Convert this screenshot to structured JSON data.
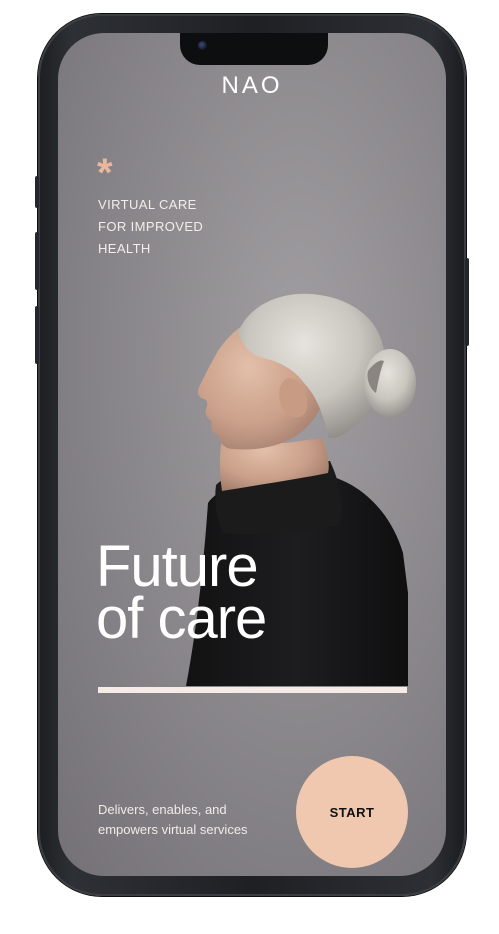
{
  "app": {
    "brand": "NAO",
    "asterisk": "*",
    "tagline_lines": [
      "VIRTUAL CARE",
      "FOR IMPROVED",
      "HEALTH"
    ]
  },
  "hero": {
    "headline_line1": "Future",
    "headline_line2": "of care"
  },
  "footer": {
    "description": "Delivers, enables, and empowers virtual services",
    "start_label": "START"
  },
  "colors": {
    "accent": "#f0c8b0",
    "asterisk": "#e8b79d",
    "background": "#8f8c90"
  },
  "icons": {
    "decorative_mark": "asterisk-icon",
    "camera": "front-camera-icon"
  }
}
